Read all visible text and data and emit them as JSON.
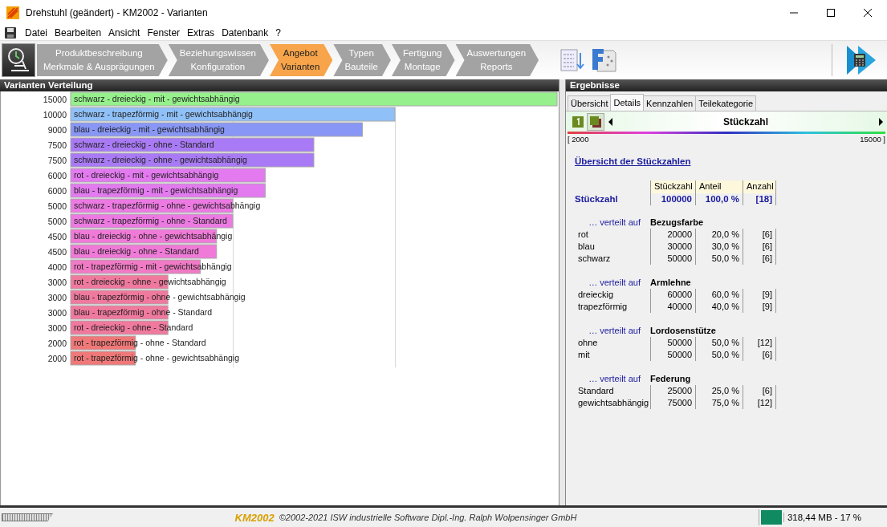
{
  "window": {
    "title": "Drehstuhl (geändert) - KM2002 - Varianten"
  },
  "menu": [
    "Datei",
    "Bearbeiten",
    "Ansicht",
    "Fenster",
    "Extras",
    "Datenbank",
    "?"
  ],
  "workflow": [
    {
      "line1": "Produktbeschreibung",
      "line2": "Merkmale & Ausprägungen",
      "selected": false
    },
    {
      "line1": "Beziehungswissen",
      "line2": "Konfiguration",
      "selected": false
    },
    {
      "line1": "Angebot",
      "line2": "Varianten",
      "selected": true
    },
    {
      "line1": "Typen",
      "line2": "Bauteile",
      "selected": false
    },
    {
      "line1": "Fertigung",
      "line2": "Montage",
      "selected": false
    },
    {
      "line1": "Auswertungen",
      "line2": "Reports",
      "selected": false
    }
  ],
  "left_panel": {
    "title": "Varianten Verteilung",
    "chart_data": {
      "type": "bar",
      "orientation": "horizontal",
      "data_labels": true,
      "categories": [
        "schwarz - dreieckig - mit - gewichtsabhängig",
        "schwarz - trapezförmig - mit - gewichtsabhängig",
        "blau - dreieckig - mit - gewichtsabhängig",
        "schwarz - dreieckig - ohne - Standard",
        "schwarz - dreieckig - ohne - gewichtsabhängig",
        "rot - dreieckig - mit - gewichtsabhängig",
        "blau - trapezförmig - mit - gewichtsabhängig",
        "schwarz - trapezförmig - ohne - gewichtsabhängig",
        "schwarz - trapezförmig - ohne - Standard",
        "blau - dreieckig - ohne - gewichtsabhängig",
        "blau - dreieckig - ohne - Standard",
        "rot - trapezförmig - mit - gewichtsabhängig",
        "rot - dreieckig - ohne - gewichtsabhängig",
        "blau - trapezförmig - ohne - gewichtsabhängig",
        "blau - trapezförmig - ohne - Standard",
        "rot - dreieckig - ohne - Standard",
        "rot - trapezförmig - ohne - Standard",
        "rot - trapezförmig - ohne - gewichtsabhängig"
      ],
      "values": [
        15000,
        10000,
        9000,
        7500,
        7500,
        6000,
        6000,
        5000,
        5000,
        4500,
        4500,
        4000,
        3000,
        3000,
        3000,
        3000,
        2000,
        2000
      ]
    }
  },
  "right_panel": {
    "title": "Ergebnisse",
    "tabs": [
      {
        "label": "Übersicht",
        "selected": false
      },
      {
        "label": "Details",
        "selected": true
      },
      {
        "label": "Kennzahlen",
        "selected": false
      },
      {
        "label": "Teilekategorie",
        "selected": false
      }
    ],
    "selector": {
      "title": "Stückzahl"
    },
    "scale": {
      "min": "[ 2000",
      "max": "15000 ]"
    },
    "link": "Übersicht der Stückzahlen",
    "columns": [
      "Stückzahl",
      "Anteil",
      "Anzahl"
    ],
    "total": {
      "label": "Stückzahl",
      "count": "100000",
      "share": "100,0 %",
      "number": "[18]"
    },
    "groups": [
      {
        "prefix": "… verteilt auf",
        "name": "Bezugsfarbe",
        "rows": [
          {
            "label": "rot",
            "count": "20000",
            "share": "20,0 %",
            "number": "[6]"
          },
          {
            "label": "blau",
            "count": "30000",
            "share": "30,0 %",
            "number": "[6]"
          },
          {
            "label": "schwarz",
            "count": "50000",
            "share": "50,0 %",
            "number": "[6]"
          }
        ]
      },
      {
        "prefix": "… verteilt auf",
        "name": "Armlehne",
        "rows": [
          {
            "label": "dreieckig",
            "count": "60000",
            "share": "60,0 %",
            "number": "[9]"
          },
          {
            "label": "trapezförmig",
            "count": "40000",
            "share": "40,0 %",
            "number": "[9]"
          }
        ]
      },
      {
        "prefix": "… verteilt auf",
        "name": "Lordosenstütze",
        "rows": [
          {
            "label": "ohne",
            "count": "50000",
            "share": "50,0 %",
            "number": "[12]"
          },
          {
            "label": "mit",
            "count": "50000",
            "share": "50,0 %",
            "number": "[6]"
          }
        ]
      },
      {
        "prefix": "… verteilt auf",
        "name": "Federung",
        "rows": [
          {
            "label": "Standard",
            "count": "25000",
            "share": "25,0 %",
            "number": "[6]"
          },
          {
            "label": "gewichtsabhängig",
            "count": "75000",
            "share": "75,0 %",
            "number": "[12]"
          }
        ]
      }
    ]
  },
  "status_bar": {
    "logo": "KM2002",
    "copyright": "©2002-2021 ISW industrielle Software Dipl.-Ing. Ralph Wolpensinger GmbH",
    "memory": "318,44 MB - 17 %"
  }
}
